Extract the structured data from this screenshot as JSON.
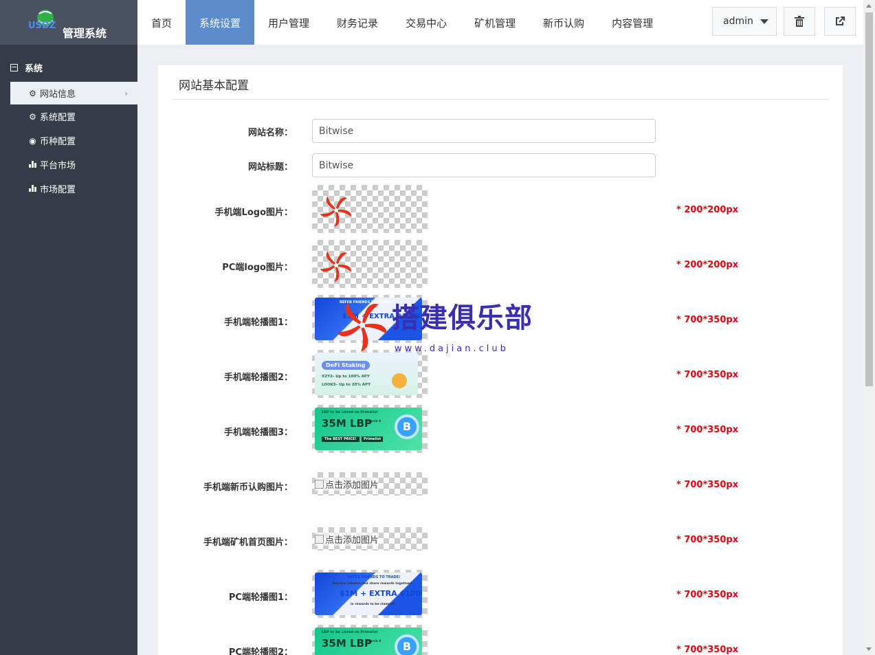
{
  "brand": {
    "logo_text": "USDZ",
    "system_name": "管理系统"
  },
  "sidebar": {
    "section_title": "系统",
    "items": [
      {
        "label": "网站信息",
        "icon": "gear-icon",
        "active": true
      },
      {
        "label": "系统配置",
        "icon": "gear-icon"
      },
      {
        "label": "币种配置",
        "icon": "target-icon"
      },
      {
        "label": "平台市场",
        "icon": "bar-chart-icon"
      },
      {
        "label": "市场配置",
        "icon": "bar-chart-icon"
      }
    ]
  },
  "topnav": {
    "tabs": [
      {
        "label": "首页"
      },
      {
        "label": "系统设置",
        "active": true
      },
      {
        "label": "用户管理"
      },
      {
        "label": "财务记录"
      },
      {
        "label": "交易中心"
      },
      {
        "label": "矿机管理"
      },
      {
        "label": "新币认购"
      },
      {
        "label": "内容管理"
      }
    ],
    "user": "admin"
  },
  "panel": {
    "title": "网站基本配置",
    "fields": {
      "site_name": {
        "label": "网站名称：",
        "value": "Bitwise"
      },
      "site_title": {
        "label": "网站标题：",
        "value": "Bitwise"
      }
    },
    "images": [
      {
        "label": "手机端Logo图片：",
        "hint": "* 200*200px"
      },
      {
        "label": "PC端logo图片：",
        "hint": "* 200*200px"
      },
      {
        "label": "手机端轮播图1：",
        "hint": "* 700*350px"
      },
      {
        "label": "手机端轮播图2：",
        "hint": "* 700*350px"
      },
      {
        "label": "手机端轮播图3：",
        "hint": "* 700*350px"
      },
      {
        "label": "手机端新币认购图片：",
        "hint": "* 700*350px",
        "alt": "点击添加图片"
      },
      {
        "label": "手机端矿机首页图片：",
        "hint": "* 700*350px",
        "alt": "点击添加图片"
      },
      {
        "label": "PC端轮播图1：",
        "hint": "* 700*350px"
      },
      {
        "label": "PC端轮播图2：",
        "hint": "* 700*350px"
      }
    ],
    "banner_texts": {
      "refer": "REFER FRIENDS TO TRADE!",
      "refer_sub": "Receive rebates and share rewards together!",
      "refer_big": "$1M + EXTRA $100K",
      "refer_foot": "in rewards to be claimed!",
      "defi": "DeFi Staking",
      "defi_l1": "X2Y2- Up to 100% APY",
      "defi_l2": "LOOKS- Up to 20% APY",
      "lbp_top": "LBP to be Listed on Primelist",
      "lbp_big": "35M LBP",
      "lbp_date": "March 9",
      "lbp_foot": "The BEST PRICE!",
      "lbp_tag": "Primelist"
    }
  },
  "watermark": {
    "text": "搭建俱乐部",
    "url": "www.dajian.club"
  }
}
